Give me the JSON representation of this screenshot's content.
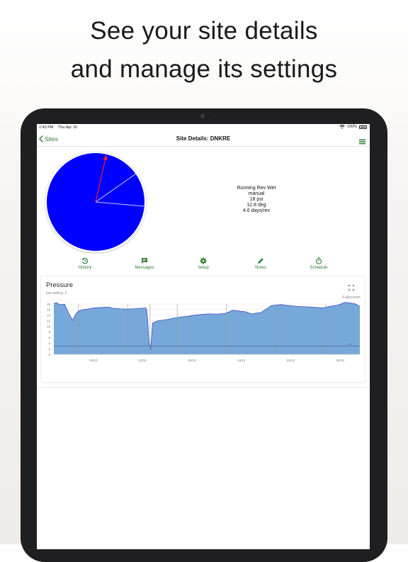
{
  "headline": {
    "line1": "See your site details",
    "line2": "and manage its settings"
  },
  "statusbar": {
    "time": "2:43 PM",
    "date": "Thu Apr 16",
    "battery": "100%"
  },
  "navbar": {
    "back_label": "Sites",
    "title": "Site Details: DNKRE"
  },
  "colors": {
    "accent": "#2e7d32",
    "pie_fill": "#0000ff",
    "chart_fill": "#76a8d9",
    "chart_line": "#2f3fbf"
  },
  "site_info": {
    "line1": "Running Rev Wet",
    "line2": "manual",
    "line3": "18 psi",
    "line4": "12.8 deg",
    "line5": "4.6 days/rev"
  },
  "pie": {
    "needle_deg": 12.8,
    "ref_lines_deg": [
      55,
      95
    ]
  },
  "tabs": [
    {
      "label": "History",
      "icon": "history-icon"
    },
    {
      "label": "Messages",
      "icon": "message-icon"
    },
    {
      "label": "Setup",
      "icon": "gear-icon"
    },
    {
      "label": "Notes",
      "icon": "pencil-icon"
    },
    {
      "label": "Schedule",
      "icon": "stopwatch-icon"
    }
  ],
  "card": {
    "title": "Pressure",
    "subtitle": "low setting: 3",
    "fullscreen_label": "Fullscreen"
  },
  "chart_data": {
    "type": "area",
    "title": "Pressure",
    "xlabel": "",
    "ylabel": "",
    "ylim": [
      0,
      18
    ],
    "yticks": [
      0,
      2,
      4,
      6,
      8,
      10,
      12,
      14,
      16,
      18
    ],
    "xticks": [
      "04/10",
      "04/11",
      "04/12",
      "04/13",
      "04/14",
      "04/15"
    ],
    "low_setting": 3,
    "low_setting_label": "Lo",
    "grid": true,
    "series": [
      {
        "x": [
          0,
          0.05,
          0.12,
          0.22,
          0.3,
          0.38,
          0.45,
          0.5,
          0.55,
          0.6,
          0.68,
          0.75,
          0.8,
          0.9,
          1.0,
          1.05,
          1.08,
          1.12,
          1.2,
          1.35,
          1.5,
          1.6,
          1.7,
          1.78,
          1.86,
          1.88,
          1.9,
          1.93,
          1.96,
          2.0,
          2.1,
          2.3,
          2.5,
          2.7,
          2.85,
          3.0,
          3.15,
          3.3,
          3.45,
          3.5,
          3.55,
          3.62,
          3.7,
          3.8,
          3.9,
          4.0,
          4.2,
          4.4,
          4.6,
          4.7,
          4.8,
          4.9,
          5.0,
          5.15,
          5.3,
          5.45,
          5.6,
          5.75,
          5.9,
          6.0,
          6.1,
          6.2
        ],
        "y": [
          18.2,
          18.5,
          17.8,
          17.9,
          14.8,
          12.2,
          14.6,
          15.5,
          15.8,
          16.0,
          16.2,
          16.4,
          16.6,
          16.7,
          16.8,
          16.9,
          16.8,
          16.9,
          16.5,
          16.3,
          16.2,
          16.3,
          16.4,
          16.5,
          16.6,
          16.1,
          12.5,
          4.0,
          1.5,
          11.2,
          12.0,
          12.5,
          13.2,
          13.6,
          14.0,
          14.3,
          14.5,
          14.4,
          14.6,
          14.8,
          15.2,
          15.8,
          15.6,
          15.4,
          15.2,
          14.5,
          15.0,
          17.4,
          17.8,
          17.6,
          17.4,
          17.2,
          17.1,
          17.0,
          16.8,
          16.6,
          17.2,
          17.6,
          18.6,
          18.4,
          18.1,
          17.2
        ]
      }
    ]
  }
}
